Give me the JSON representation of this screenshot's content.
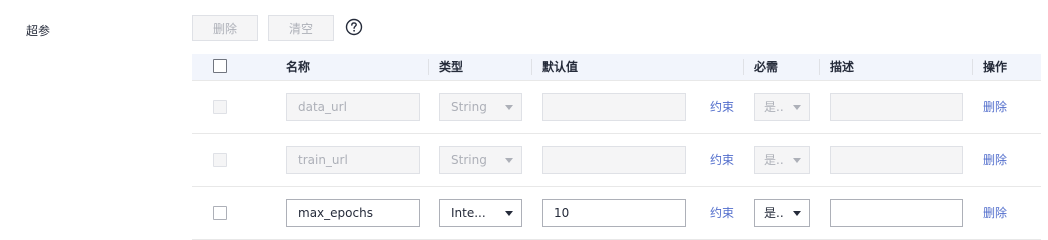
{
  "section": {
    "label": "超参"
  },
  "toolbar": {
    "delete_label": "删除",
    "clear_label": "清空",
    "help_icon": "question-circle-icon"
  },
  "table": {
    "headers": {
      "name": "名称",
      "type": "类型",
      "default": "默认值",
      "required": "必需",
      "description": "描述",
      "action": "操作"
    },
    "rows": [
      {
        "name": "data_url",
        "type": "String",
        "default": "",
        "constraint": "约束",
        "required": "是..",
        "description": "",
        "delete": "删除",
        "disabled": true
      },
      {
        "name": "train_url",
        "type": "String",
        "default": "",
        "constraint": "约束",
        "required": "是..",
        "description": "",
        "delete": "删除",
        "disabled": true
      },
      {
        "name": "max_epochs",
        "type": "Inte...",
        "default": "10",
        "constraint": "约束",
        "required": "是..",
        "description": "",
        "delete": "删除",
        "disabled": false
      }
    ]
  }
}
